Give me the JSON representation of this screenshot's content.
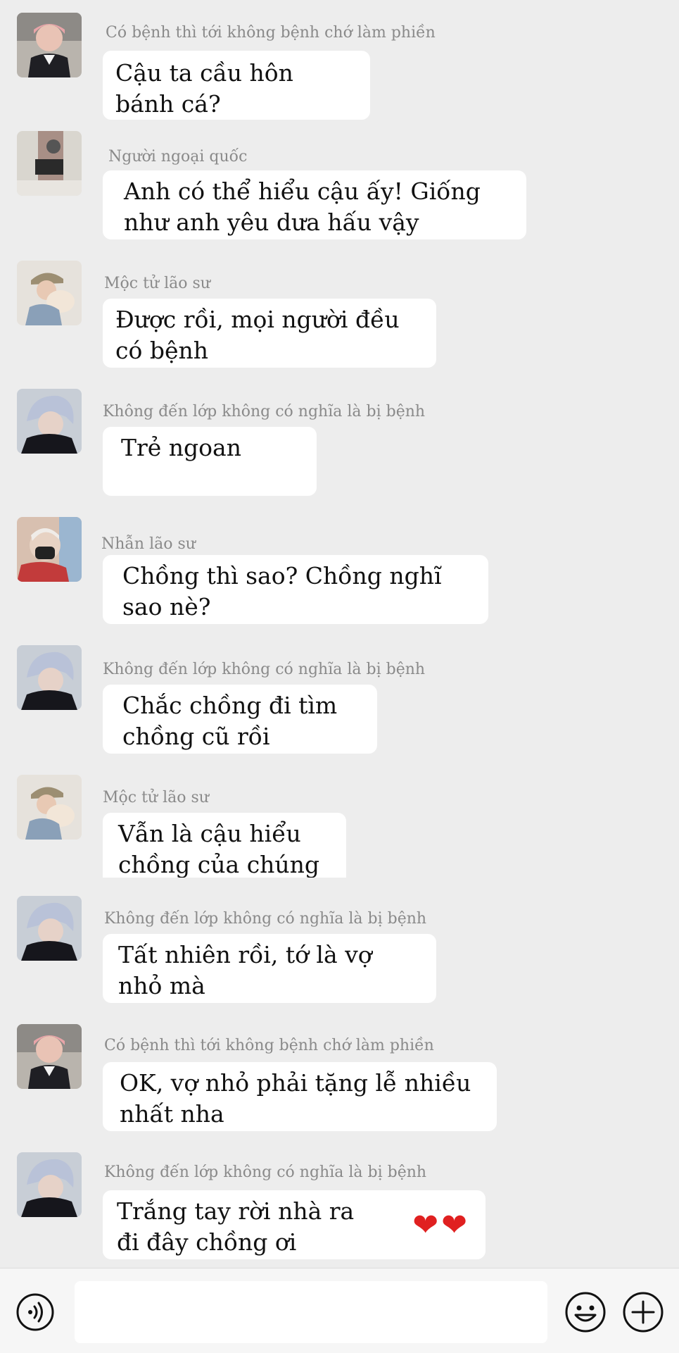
{
  "messages": [
    {
      "sender": "Có bệnh thì tới không bệnh chớ làm phiền",
      "text": "Cậu ta cầu hôn bánh cá?",
      "avatar": "avatar-pink-hair"
    },
    {
      "sender": "Người ngoại quốc",
      "text": "Anh có thể hiểu cậu ấy! Giống như anh yêu dưa hấu vậy",
      "avatar": "avatar-mirror-selfie"
    },
    {
      "sender": "Mộc tử lão sư",
      "text": "Được rồi, mọi người đều có bệnh",
      "avatar": "avatar-hat-puppy"
    },
    {
      "sender": "Không đến lớp không có nghĩa là bị bệnh",
      "text": "Trẻ ngoan",
      "avatar": "avatar-silver-hair"
    },
    {
      "sender": "Nhẫn lão sư",
      "text": "Chồng thì sao? Chồng nghĩ sao nè?",
      "avatar": "avatar-mask"
    },
    {
      "sender": "Không đến lớp không có nghĩa là bị bệnh",
      "text": "Chắc chồng đi tìm chồng cũ rồi",
      "avatar": "avatar-silver-hair"
    },
    {
      "sender": "Mộc tử lão sư",
      "text": "Vẫn là cậu hiểu chồng của chúng ta",
      "avatar": "avatar-hat-puppy"
    },
    {
      "sender": "Không đến lớp không có nghĩa là bị bệnh",
      "text": "Tất nhiên rồi, tớ là vợ nhỏ mà",
      "avatar": "avatar-silver-hair"
    },
    {
      "sender": "Có bệnh thì tới không bệnh chớ làm phiền",
      "text": "OK, vợ nhỏ phải tặng lễ nhiều nhất nha",
      "avatar": "avatar-pink-hair"
    },
    {
      "sender": "Không đến lớp không có nghĩa là bị bệnh",
      "text": "Trắng tay rời nhà ra đi đây chồng ơi",
      "hearts": "❤❤",
      "avatar": "avatar-silver-hair"
    }
  ],
  "input": {
    "value": "",
    "placeholder": ""
  },
  "icons": {
    "voice": "voice-icon",
    "emoji": "emoji-icon",
    "plus": "plus-icon"
  },
  "colors": {
    "background": "#ededed",
    "bubble": "#ffffff",
    "sender": "#8a8a8a",
    "heart": "#e02020"
  }
}
